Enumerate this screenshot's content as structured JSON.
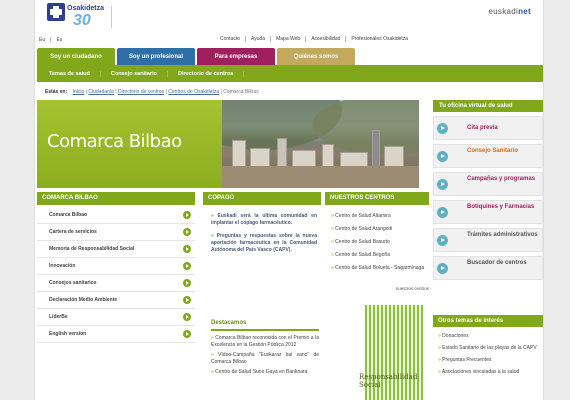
{
  "header": {
    "logo_name": "Osakidetza",
    "logo_number": "30",
    "logo_sub": "Osakidetza 30 urte",
    "euskadi_left": "euskadi",
    "euskadi_right": "net"
  },
  "lang": {
    "es": "Eu",
    "sep": "|",
    "eu": "Es"
  },
  "toplinks": [
    "Contacto",
    "Ayuda",
    "Mapa Web",
    "Accesibilidad",
    "Profesionales Osakidetza"
  ],
  "tabs": [
    {
      "label": "Soy un ciudadano",
      "color": "#80a81a"
    },
    {
      "label": "Soy un profesional",
      "color": "#2f6fa8"
    },
    {
      "label": "Para empresas",
      "color": "#a0205f"
    },
    {
      "label": "Quiénes somos",
      "color": "#c3a95b"
    }
  ],
  "subnav": [
    "Temas de salud",
    "Consejo sanitario",
    "Directorio de centros"
  ],
  "breadcrumb": {
    "label": "Estás en:",
    "items": [
      "Inicio",
      "Ciudadanía",
      "Directorio de centros",
      "Centros de Osakidetza",
      "Comarca Bilbao"
    ]
  },
  "hero": {
    "title": "Comarca Bilbao"
  },
  "oficina": {
    "title": "Tu oficina virtual de salud",
    "items": [
      {
        "label": "Cita previa",
        "color": "#a0205f"
      },
      {
        "label": "Consejo Sanitario",
        "color": "#e06a16"
      },
      {
        "label": "Campañas y programas",
        "color": "#a0205f"
      },
      {
        "label": "Botiquines y Farmacias",
        "color": "#a0205f"
      },
      {
        "label": "Trámites administrativos",
        "color": "#555555"
      },
      {
        "label": "Buscador de centros",
        "color": "#555555"
      }
    ]
  },
  "leftnav": {
    "title": "COMARCA BILBAO",
    "items": [
      "Comarca Bilbao",
      "Cartera de servicios",
      "Memoria de Responsabilidad Social",
      "Innovación",
      "Consejos sanitarios",
      "Declaración Medio Ambiente",
      "LiderBe",
      "English version"
    ]
  },
  "copago": {
    "title": "COPAGO",
    "items": [
      "Euskadi será la última comunidad en implantar el copago farmacéutico.",
      "Preguntas y respuestas sobre la nueva aportación farmacéutica en la Comunidad Autónoma del País Vasco (CAPV)."
    ]
  },
  "centros": {
    "title": "NUESTROS CENTROS",
    "items": [
      "Centro de Salud Altamira",
      "Centro de Salud Arangoiti",
      "Centro de Salud Basurto",
      "Centro de Salud Begoña",
      "Centro de Salud Bolueta - Sagarmínaga"
    ],
    "more": "nuestros centros"
  },
  "destacados": {
    "title": "Destacamos",
    "items": [
      "Comarca Bilbao reconocida con el Premio a la Excelencia en la Gestión Pública 2012",
      "Vídeo-Campaña \"Euskaraz bai sano\" de Comarca Bilbao",
      "Centro de Salud Suno Gaya en Bankoara"
    ]
  },
  "resp": {
    "line1": "Responsabilidad",
    "line2": "Social"
  },
  "otros": {
    "title": "Otros temas de interés",
    "items": [
      "Donaciones",
      "Estado Sanitario de las playas de la CAPV",
      "Preguntas Frecuentes",
      "Asociaciones vinculadas a la salud"
    ]
  }
}
